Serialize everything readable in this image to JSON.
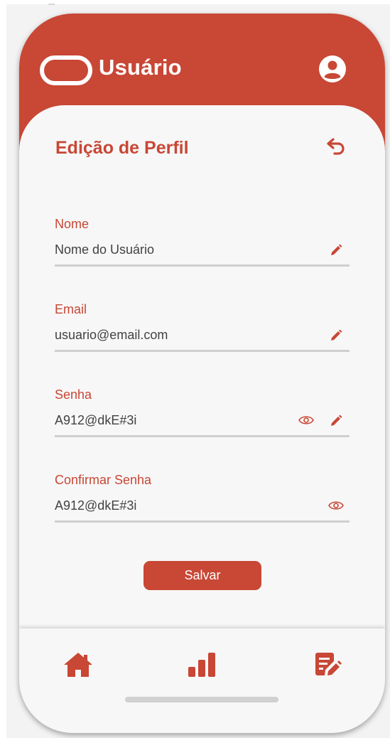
{
  "header": {
    "title": "Usuário",
    "logo_icon": "pill-logo-icon",
    "profile_icon": "user-circle-icon"
  },
  "form": {
    "title": "Edição de Perfil",
    "back_icon": "undo-arrow-icon",
    "fields": [
      {
        "label": "Nome",
        "value": "Nome do Usuário",
        "icons": [
          "pencil-icon"
        ]
      },
      {
        "label": "Email",
        "value": "usuario@email.com",
        "icons": [
          "pencil-icon"
        ]
      },
      {
        "label": "Senha",
        "value": "A912@dkE#3i",
        "icons": [
          "eye-icon",
          "pencil-icon"
        ]
      },
      {
        "label": "Confirmar Senha",
        "value": "A912@dkE#3i",
        "icons": [
          "eye-icon"
        ]
      }
    ],
    "save_label": "Salvar"
  },
  "bottom_nav": {
    "items": [
      {
        "icon": "home-icon"
      },
      {
        "icon": "bar-chart-icon"
      },
      {
        "icon": "edit-document-icon"
      }
    ]
  },
  "colors": {
    "accent": "#c84735",
    "background": "#f7f7f7",
    "text": "#424242",
    "divider": "#cfcfcf"
  }
}
